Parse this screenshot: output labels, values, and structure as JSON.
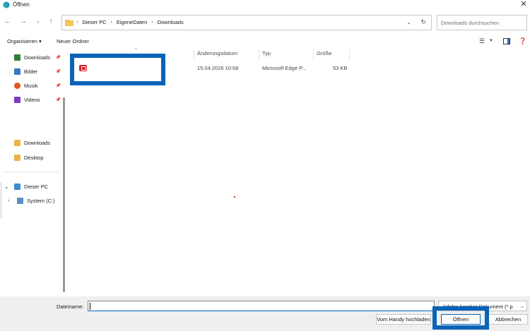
{
  "window": {
    "title": "Öffnen",
    "app_icon": "edge-icon",
    "close_icon": "close-icon"
  },
  "navigation": {
    "back_icon": "back-arrow-icon",
    "forward_icon": "forward-arrow-icon",
    "history_icon": "chevron-down-icon",
    "up_icon": "up-arrow-icon",
    "breadcrumb": [
      "Dieser PC",
      "EigeneDaten",
      "Downloads"
    ],
    "search_placeholder": "Downloads durchsuchen"
  },
  "toolbar": {
    "organize_label": "Organisieren ▾",
    "new_folder_label": "Neuer Ordner"
  },
  "sidebar": {
    "quick_access": [
      {
        "label": "Downloads",
        "icon": "download-icon",
        "color": "#2f7d3a",
        "pinned": true
      },
      {
        "label": "Bilder",
        "icon": "pictures-icon",
        "color": "#3a76c4",
        "pinned": true
      },
      {
        "label": "Musik",
        "icon": "music-icon",
        "color": "#e0551f",
        "pinned": true
      },
      {
        "label": "Videos",
        "icon": "videos-icon",
        "color": "#7d3bbd",
        "pinned": true
      }
    ],
    "folders": [
      {
        "label": "Downloads",
        "icon": "folder-icon",
        "color": "#e8b44a"
      },
      {
        "label": "Desktop",
        "icon": "folder-icon",
        "color": "#e8b44a"
      }
    ],
    "this_pc": {
      "label": "Dieser PC",
      "icon": "monitor-icon",
      "color": "#3a8ccf"
    },
    "drive": {
      "label": "System (C:)",
      "icon": "drive-icon",
      "color": "#5b8fc7"
    }
  },
  "file_list": {
    "columns": [
      "Änderungsdatum",
      "Typ",
      "Größe"
    ],
    "rows": [
      {
        "name": "",
        "date": "15.04.2026 10:58",
        "type": "Microsoft Edge P...",
        "size": "53 KB",
        "icon": "pdf-icon",
        "color": "#d6232b"
      }
    ]
  },
  "footer": {
    "filename_label": "Dateiname:",
    "filename_value": "",
    "filetype_value": "Adobe Acrobat-Dokument (*.p",
    "upload_button": "Vom Handy hochladen",
    "open_button": "Öffnen",
    "cancel_button": "Abbrechen"
  },
  "colors": {
    "highlight": "#0a63b8",
    "accent": "#0067c0",
    "footer_bg": "#efefef"
  }
}
